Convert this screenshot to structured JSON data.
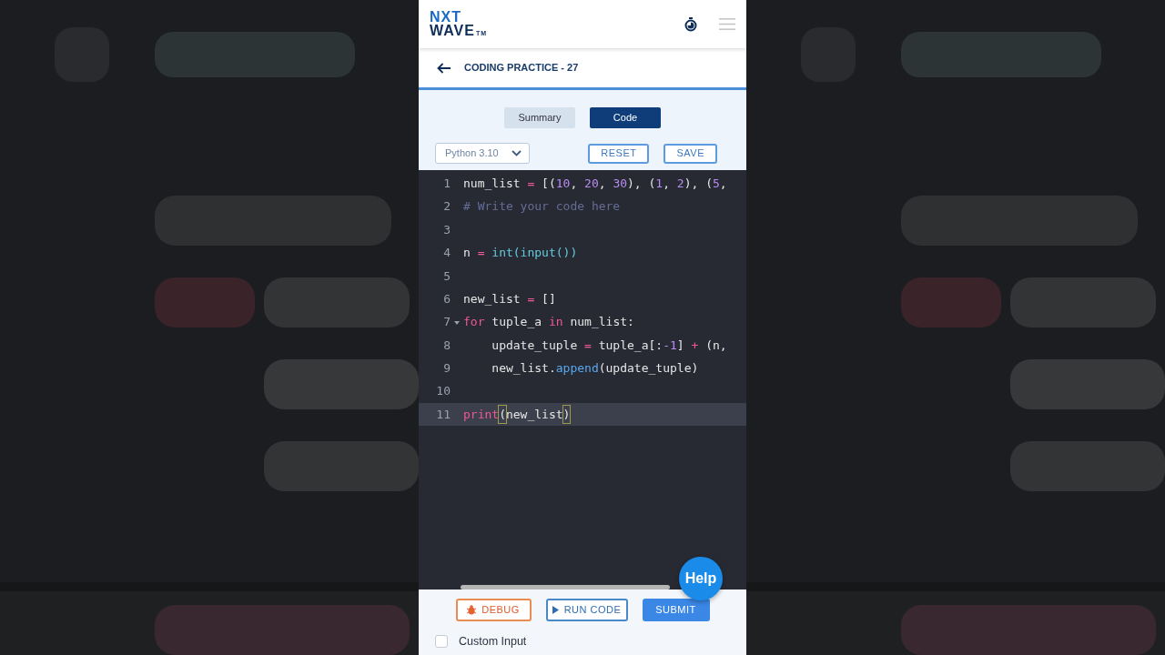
{
  "header": {
    "logo_top": "NXT",
    "logo_bottom": "WAVE",
    "logo_mark": "TM"
  },
  "title_bar": {
    "title": "CODING PRACTICE - 27"
  },
  "tabs": [
    {
      "label": "Summary",
      "selected": false
    },
    {
      "label": "Code",
      "selected": true
    }
  ],
  "language": {
    "value": "Python 3.10"
  },
  "actions": [
    "RESET",
    "SAVE"
  ],
  "code_lines": [
    {
      "number": "1",
      "fold": false,
      "active": false,
      "tokens": [
        {
          "text": "num_list ",
          "kind": "plain"
        },
        {
          "text": "=",
          "kind": "operator"
        },
        {
          "text": " [(",
          "kind": "plain"
        },
        {
          "text": "10",
          "kind": "number"
        },
        {
          "text": ", ",
          "kind": "plain"
        },
        {
          "text": "20",
          "kind": "number"
        },
        {
          "text": ", ",
          "kind": "plain"
        },
        {
          "text": "30",
          "kind": "number"
        },
        {
          "text": "), (",
          "kind": "plain"
        },
        {
          "text": "1",
          "kind": "number"
        },
        {
          "text": ", ",
          "kind": "plain"
        },
        {
          "text": "2",
          "kind": "number"
        },
        {
          "text": "), (",
          "kind": "plain"
        },
        {
          "text": "5",
          "kind": "number"
        },
        {
          "text": ",",
          "kind": "plain"
        }
      ]
    },
    {
      "number": "2",
      "fold": false,
      "active": false,
      "tokens": [
        {
          "text": "# Write your code here",
          "kind": "comment"
        }
      ]
    },
    {
      "number": "3",
      "fold": false,
      "active": false
    },
    {
      "number": "4",
      "fold": false,
      "active": false,
      "tokens": [
        {
          "text": "n ",
          "kind": "plain"
        },
        {
          "text": "=",
          "kind": "operator"
        },
        {
          "text": " int(input())",
          "kind": "builtin"
        }
      ]
    },
    {
      "number": "5",
      "fold": false,
      "active": false
    },
    {
      "number": "6",
      "fold": false,
      "active": false,
      "tokens": [
        {
          "text": "new_list ",
          "kind": "plain"
        },
        {
          "text": "=",
          "kind": "operator"
        },
        {
          "text": " []",
          "kind": "plain"
        }
      ]
    },
    {
      "number": "7",
      "fold": true,
      "active": false,
      "tokens": [
        {
          "text": "for",
          "kind": "keyword"
        },
        {
          "text": " tuple_a ",
          "kind": "plain"
        },
        {
          "text": "in",
          "kind": "keyword"
        },
        {
          "text": " num_list:",
          "kind": "plain"
        }
      ]
    },
    {
      "number": "8",
      "fold": false,
      "active": false,
      "tokens": [
        {
          "text": "    update_tuple ",
          "kind": "plain"
        },
        {
          "text": "=",
          "kind": "operator"
        },
        {
          "text": " tuple_a[:",
          "kind": "plain"
        },
        {
          "text": "-1",
          "kind": "number"
        },
        {
          "text": "] ",
          "kind": "plain"
        },
        {
          "text": "+",
          "kind": "operator"
        },
        {
          "text": " (n,",
          "kind": "plain"
        }
      ]
    },
    {
      "number": "9",
      "fold": false,
      "active": false,
      "tokens": [
        {
          "text": "    new_list.",
          "kind": "plain"
        },
        {
          "text": "append",
          "kind": "method"
        },
        {
          "text": "(update_tuple)",
          "kind": "plain"
        }
      ]
    },
    {
      "number": "10",
      "fold": false,
      "active": false
    },
    {
      "number": "11",
      "fold": false,
      "active": true,
      "tokens": [
        {
          "text": "print",
          "kind": "keyword"
        },
        {
          "text": "(",
          "kind": "matched"
        },
        {
          "text": "new_list",
          "kind": "plain"
        },
        {
          "text": ")",
          "kind": "matched"
        }
      ]
    }
  ],
  "help": "Help",
  "footer_buttons": [
    {
      "label": "DEBUG",
      "kind": "debug"
    },
    {
      "label": "RUN CODE",
      "kind": "run"
    },
    {
      "label": "SUBMIT",
      "kind": "submit"
    }
  ],
  "custom_input": {
    "label": "Custom Input",
    "checked": false
  }
}
